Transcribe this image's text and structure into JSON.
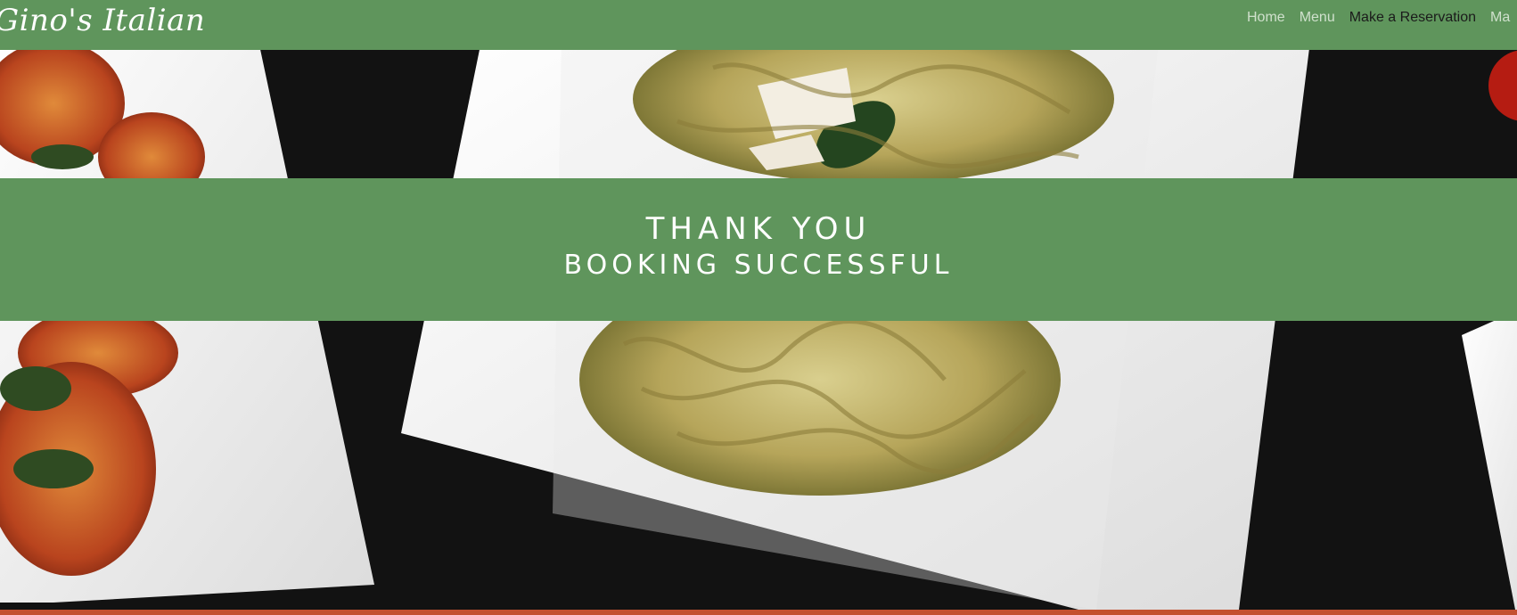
{
  "brand": {
    "name": "Gino's Italian"
  },
  "nav": {
    "items": [
      {
        "label": "Home"
      },
      {
        "label": "Menu"
      },
      {
        "label": "Make a Reservation"
      },
      {
        "label": "Ma"
      }
    ]
  },
  "banner": {
    "title": "THANK YOU",
    "subtitle": "BOOKING SUCCESSFUL"
  },
  "colors": {
    "brand_green": "#5f955c",
    "nav_text": "#cfe0cc",
    "nav_active_text": "#1b1b1b",
    "footer_accent": "#c4502f",
    "photo_background": "#121212"
  }
}
